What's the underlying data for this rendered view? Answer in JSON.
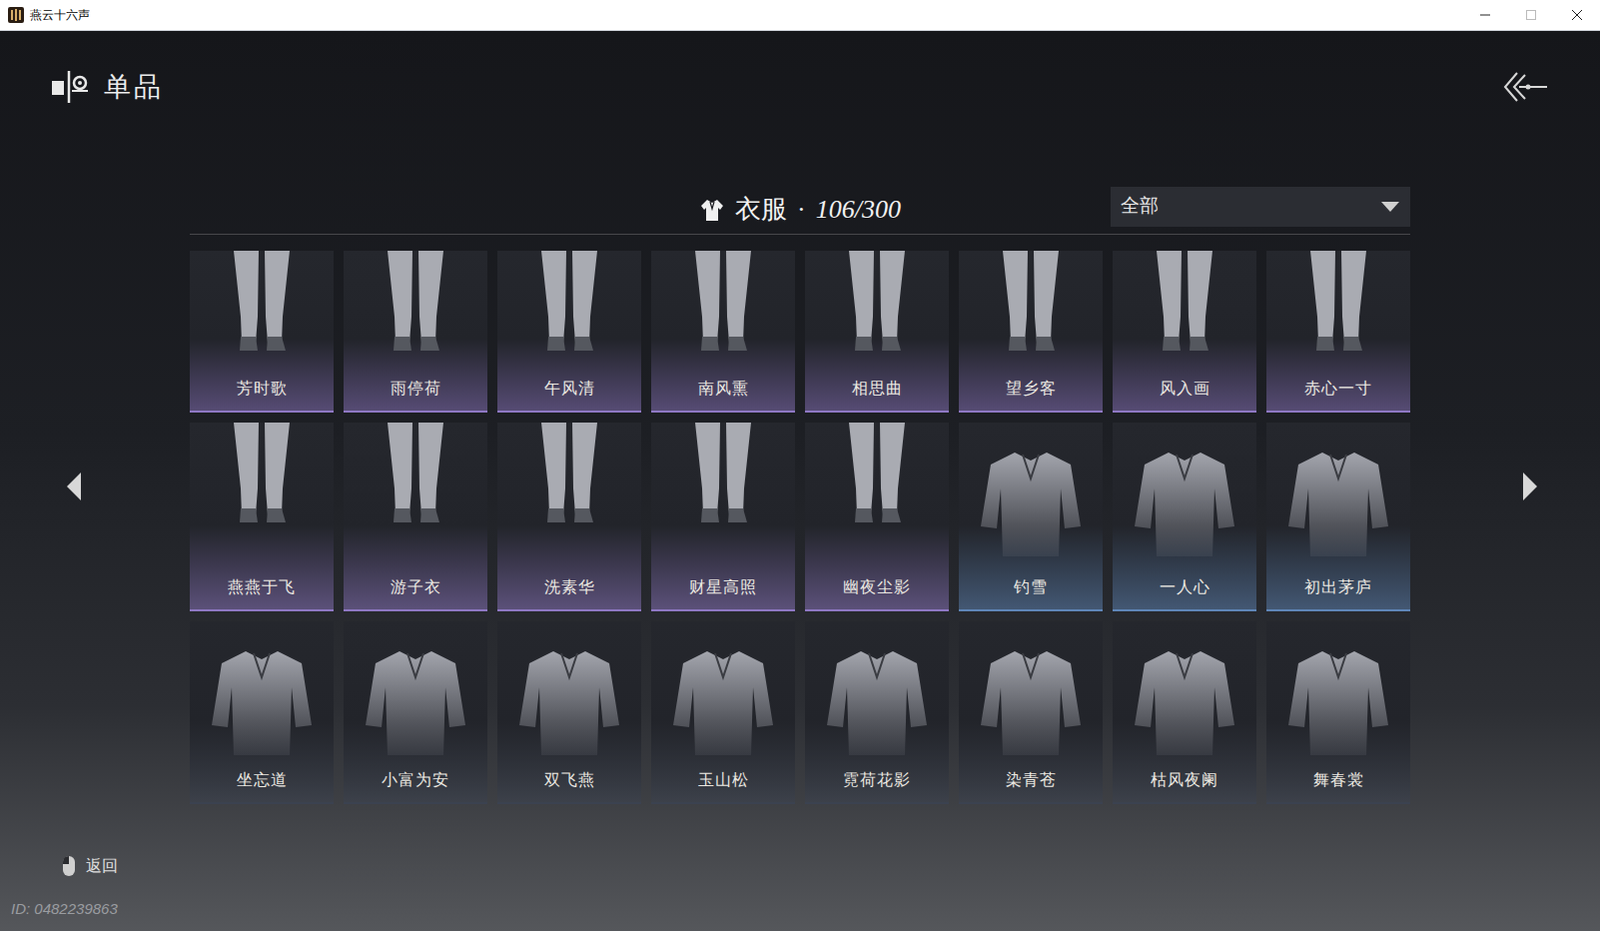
{
  "window": {
    "title": "燕云十六声"
  },
  "header": {
    "title": "单品"
  },
  "category": {
    "name": "衣服",
    "dot": "·",
    "count": "106/300"
  },
  "filter": {
    "value": "全部"
  },
  "items": [
    {
      "name": "芳时歌",
      "kind": "legwear",
      "color": "#8f78c4"
    },
    {
      "name": "雨停荷",
      "kind": "legwear",
      "color": "#8f78c4"
    },
    {
      "name": "午风清",
      "kind": "legwear",
      "color": "#8f78c4"
    },
    {
      "name": "南风熏",
      "kind": "legwear",
      "color": "#8f78c4"
    },
    {
      "name": "相思曲",
      "kind": "legwear",
      "color": "#8f78c4"
    },
    {
      "name": "望乡客",
      "kind": "legwear",
      "color": "#8f78c4"
    },
    {
      "name": "风入画",
      "kind": "legwear",
      "color": "#8f78c4"
    },
    {
      "name": "赤心一寸",
      "kind": "legwear",
      "color": "#8f78c4"
    },
    {
      "name": "燕燕于飞",
      "kind": "legwear",
      "color": "#8f78c4"
    },
    {
      "name": "游子衣",
      "kind": "legwear",
      "color": "#8f78c4"
    },
    {
      "name": "洗素华",
      "kind": "legwear",
      "color": "#8f78c4"
    },
    {
      "name": "财星高照",
      "kind": "legwear",
      "color": "#8f78c4"
    },
    {
      "name": "幽夜尘影",
      "kind": "legwear",
      "color": "#8f78c4"
    },
    {
      "name": "钓雪",
      "kind": "top",
      "color": "#5f86b8"
    },
    {
      "name": "一人心",
      "kind": "top",
      "color": "#5f86b8"
    },
    {
      "name": "初出茅庐",
      "kind": "top",
      "color": "#5f86b8"
    },
    {
      "name": "坐忘道",
      "kind": "top",
      "color": "#3b4250"
    },
    {
      "name": "小富为安",
      "kind": "top",
      "color": "#3b4250"
    },
    {
      "name": "双飞燕",
      "kind": "top",
      "color": "#3b4250"
    },
    {
      "name": "玉山松",
      "kind": "top",
      "color": "#3b4250"
    },
    {
      "name": "霓荷花影",
      "kind": "top",
      "color": "#3b4250"
    },
    {
      "name": "染青苍",
      "kind": "top",
      "color": "#3b4250"
    },
    {
      "name": "枯风夜阑",
      "kind": "top",
      "color": "#3b4250"
    },
    {
      "name": "舞春裳",
      "kind": "top",
      "color": "#3b4250"
    }
  ],
  "footer": {
    "back": "返回",
    "id": "ID: 0482239863"
  }
}
